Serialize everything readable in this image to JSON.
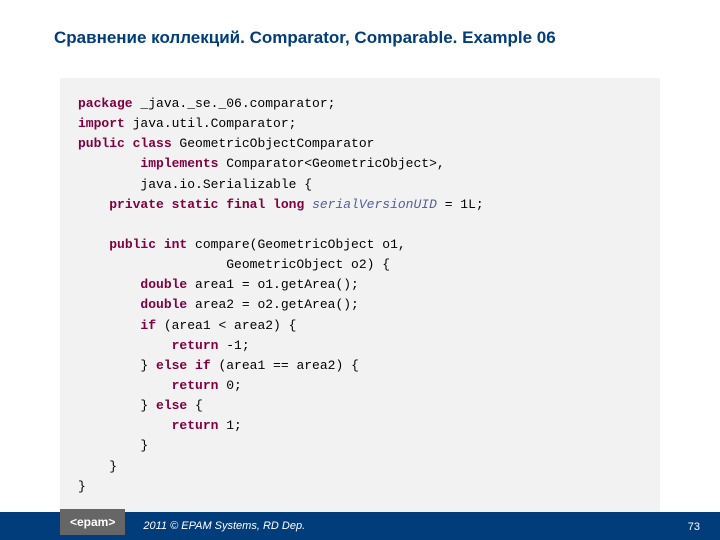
{
  "title": "Сравнение коллекций. Comparator, Comparable. Example 06",
  "code": {
    "l1": {
      "k1": "package",
      "t1": " _java._se._06.comparator;"
    },
    "l2": {
      "k1": "import",
      "t1": " java.util.Comparator;"
    },
    "l3": {
      "k1": "public class",
      "t1": " GeometricObjectComparator"
    },
    "l4": {
      "k1": "implements",
      "t1": " Comparator<GeometricObject>,"
    },
    "l5": {
      "t1": "        java.io.Serializable {"
    },
    "l6": {
      "k1": "private static final long",
      "i1": " serialVersionUID",
      "t1": " = 1L;"
    },
    "l7": "",
    "l8": {
      "k1": "public int",
      "t1": " compare(GeometricObject o1,"
    },
    "l9": {
      "t1": "                   GeometricObject o2) {"
    },
    "l10": {
      "k1": "double",
      "t1": " area1 = o1.getArea();"
    },
    "l11": {
      "k1": "double",
      "t1": " area2 = o2.getArea();"
    },
    "l12": {
      "k1": "if",
      "t1": " (area1 < area2) {"
    },
    "l13": {
      "k1": "return",
      "t1": " -1;"
    },
    "l14": {
      "t1": "} ",
      "k1": "else if",
      "t2": " (area1 == area2) {"
    },
    "l15": {
      "k1": "return",
      "t1": " 0;"
    },
    "l16": {
      "t1": "} ",
      "k1": "else",
      "t2": " {"
    },
    "l17": {
      "k1": "return",
      "t1": " 1;"
    },
    "l18": {
      "t1": "}"
    },
    "l19": {
      "t1": "}"
    },
    "l20": {
      "t1": "}"
    }
  },
  "footer": {
    "logo": "<epam>",
    "text": "2011 © EPAM Systems, RD Dep.",
    "page": "73"
  }
}
